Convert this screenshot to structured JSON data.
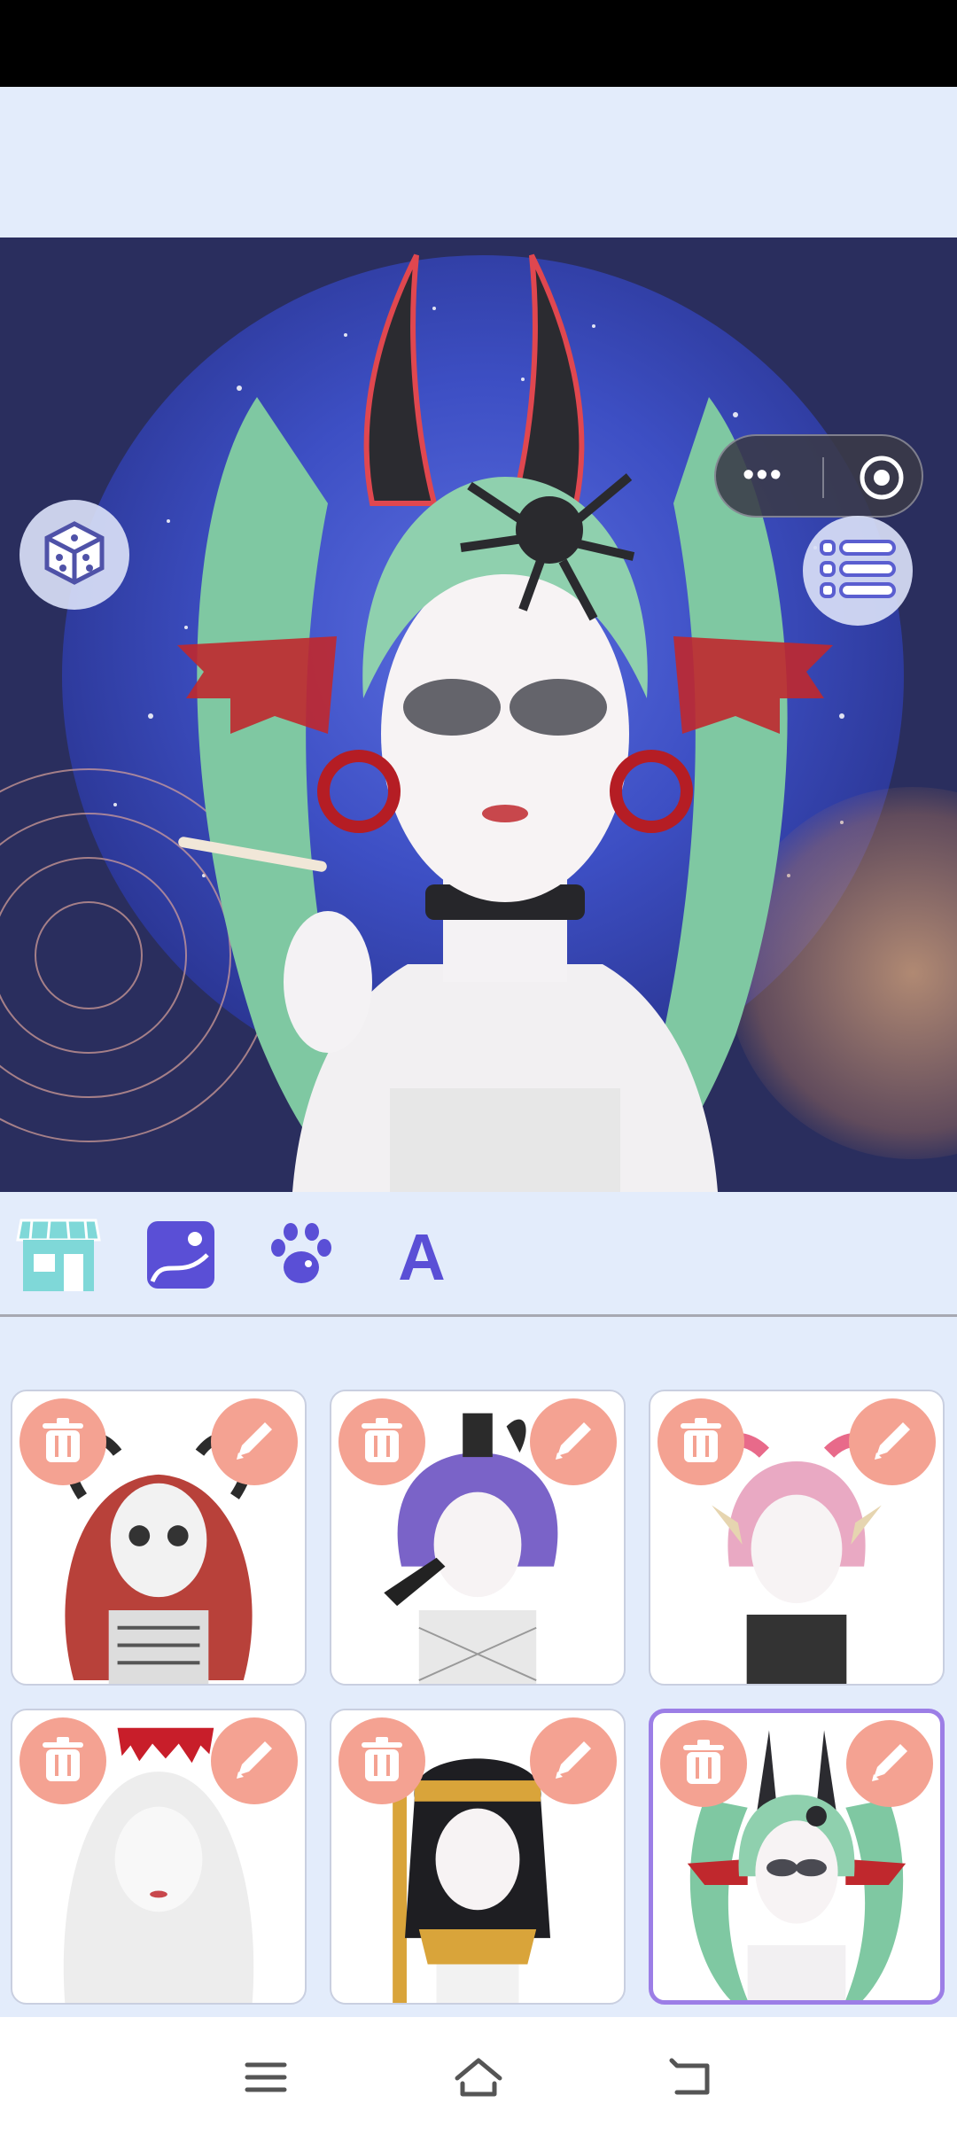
{
  "app": {
    "mini_program_capsule": {
      "more": "•••",
      "close_icon": "target-icon"
    }
  },
  "stage": {
    "buttons": {
      "random": "dice-icon",
      "menu": "list-icon",
      "delete": "trash-icon",
      "collapse": "double-chevron-left-icon"
    }
  },
  "tabs": [
    {
      "id": "shop",
      "icon": "shop-icon",
      "active": true
    },
    {
      "id": "background",
      "icon": "background-image-icon",
      "active": false
    },
    {
      "id": "pets",
      "icon": "paw-icon",
      "active": false
    },
    {
      "id": "text",
      "icon": "letter-a-icon",
      "label": "A",
      "active": false
    }
  ],
  "saved_characters": [
    {
      "theme": "skeleton",
      "selected": false
    },
    {
      "theme": "purple-hair-pistol",
      "selected": false
    },
    {
      "theme": "pink-hair-bows",
      "selected": false
    },
    {
      "theme": "white-veil",
      "selected": false
    },
    {
      "theme": "pharaoh",
      "selected": false
    },
    {
      "theme": "green-twintails-horns",
      "selected": true
    }
  ],
  "colors": {
    "page_bg": "#e3ecfb",
    "accent_purple": "#5a4fd6",
    "card_button": "#f4a292",
    "selected_border": "#9c7ee6",
    "stage_bg": "#2a2e5e"
  },
  "nav": {
    "menu": "menu-icon",
    "home": "home-icon",
    "back": "back-icon"
  }
}
